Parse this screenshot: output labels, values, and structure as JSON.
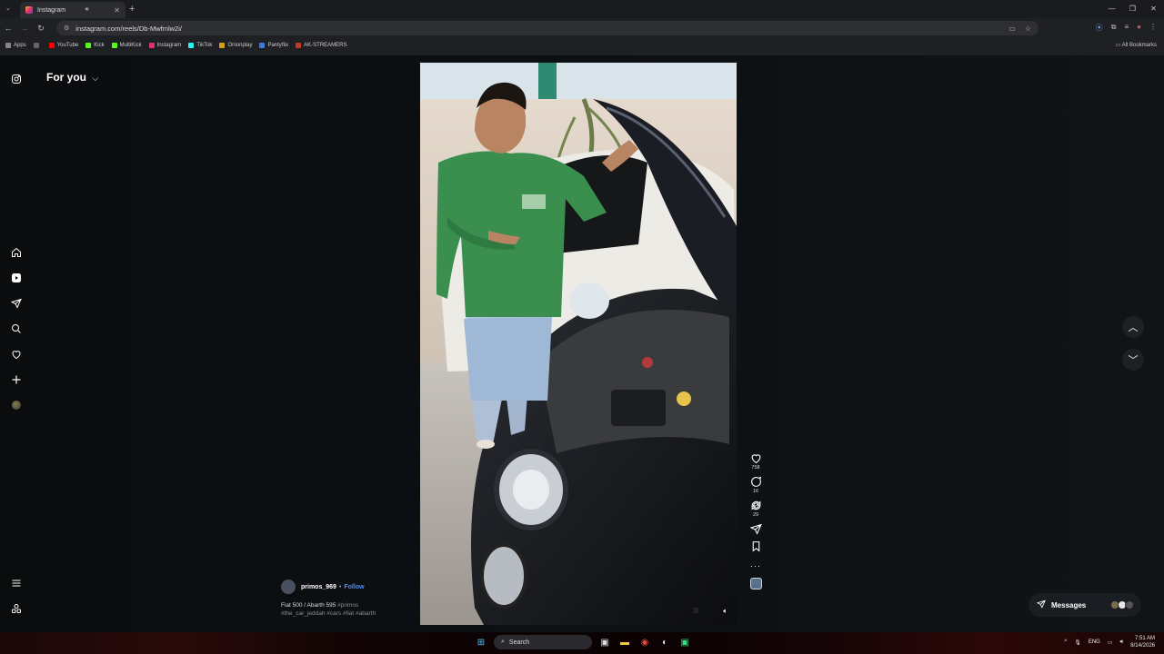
{
  "browser": {
    "tab_title": "Instagram",
    "url": "instagram.com/reels/Db-Mwfmlw2i/",
    "bookmarks": [
      "Apps",
      "YouTube",
      "Kick",
      "MultiKick",
      "Instagram",
      "TikTok",
      "Onionplay",
      "Pantyflix",
      "AK-STREAMERS"
    ],
    "all_bookmarks": "All Bookmarks"
  },
  "feed": {
    "title": "For you"
  },
  "reel": {
    "counts": {
      "likes": "758",
      "comments": "16",
      "reposts": "29"
    },
    "owner": "primos_969",
    "follow_label": "Follow",
    "separator": "•",
    "caption_title": "Fiat 500 / Abarth 595",
    "caption_tags_line1": "#primos",
    "caption_tags_line2": "#the_car_jeddah #cars #fiat #abarth"
  },
  "messages": {
    "label": "Messages"
  },
  "taskbar": {
    "search_placeholder": "Search",
    "lang": "ENG",
    "time": "7:51 AM",
    "date": "8/14/2026"
  },
  "colors": {
    "accent_follow": "#4f8cff",
    "page_bg": "#0b0d10",
    "shirt_green": "#3a8f4e"
  }
}
